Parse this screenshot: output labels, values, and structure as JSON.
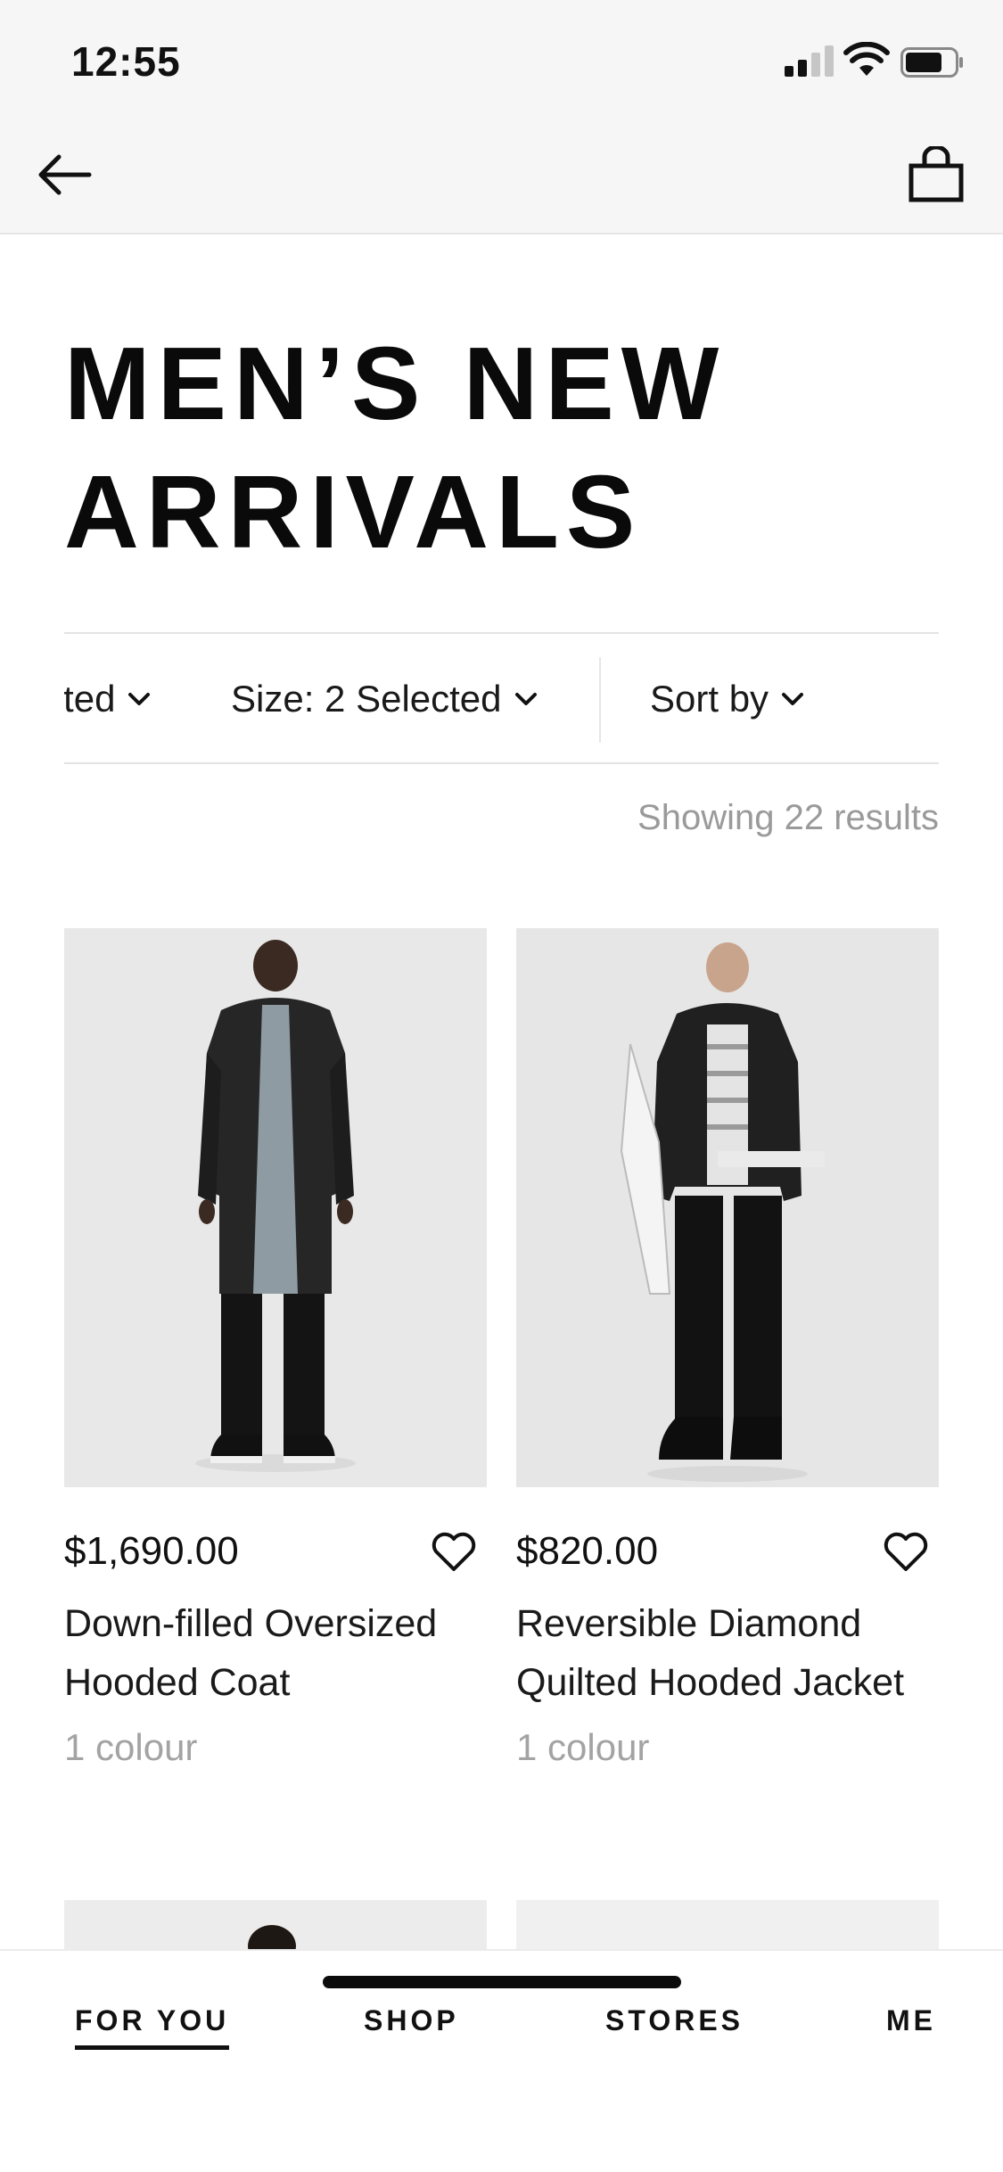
{
  "status_bar": {
    "time": "12:55",
    "icons": [
      "cellular-signal-icon",
      "wifi-icon",
      "battery-icon"
    ]
  },
  "header": {
    "back_icon": "arrow-left-icon",
    "bag_icon": "shopping-bag-icon"
  },
  "page": {
    "title": "MEN’S NEW ARRIVALS"
  },
  "filters": {
    "items": [
      {
        "label": "elected"
      },
      {
        "label": "Size: 2 Selected"
      },
      {
        "label": "Sort by"
      }
    ]
  },
  "results": {
    "text": "Showing 22 results"
  },
  "products": [
    {
      "price": "$1,690.00",
      "name": "Down-filled Oversized Hooded Coat",
      "colours": "1 colour",
      "favourite_icon": "heart-outline-icon"
    },
    {
      "price": "$820.00",
      "name": "Reversible Diamond Quilted Hooded Jacket",
      "colours": "1 colour",
      "favourite_icon": "heart-outline-icon"
    }
  ],
  "tabs": [
    {
      "label": "FOR YOU",
      "active": true
    },
    {
      "label": "SHOP",
      "active": false
    },
    {
      "label": "STORES",
      "active": false
    },
    {
      "label": "ME",
      "active": false
    }
  ],
  "colors": {
    "text": "#111111",
    "muted": "#9a9a9a",
    "header_bg": "#f6f6f6",
    "image_bg": "#e9e9e9"
  }
}
